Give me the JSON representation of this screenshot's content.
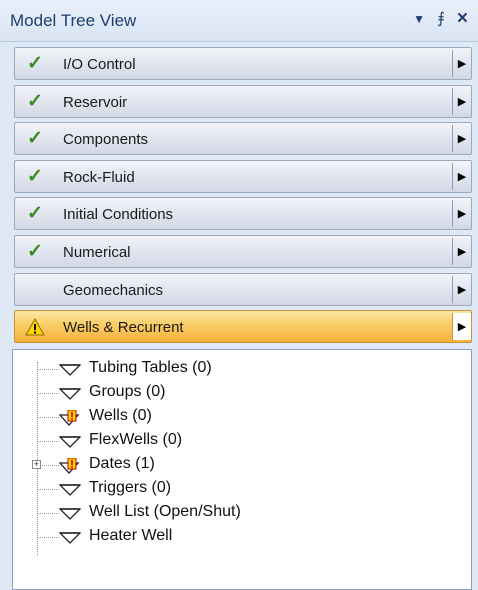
{
  "header": {
    "title": "Model Tree View",
    "dropdown_icon": "chevron-down-icon",
    "pin_icon": "pin-icon",
    "close_icon": "close-icon"
  },
  "sections": [
    {
      "label": "I/O Control",
      "status": "check"
    },
    {
      "label": "Reservoir",
      "status": "check"
    },
    {
      "label": "Components",
      "status": "check"
    },
    {
      "label": "Rock-Fluid",
      "status": "check"
    },
    {
      "label": "Initial Conditions",
      "status": "check"
    },
    {
      "label": "Numerical",
      "status": "check"
    },
    {
      "label": "Geomechanics",
      "status": "none"
    },
    {
      "label": "Wells & Recurrent",
      "status": "warning",
      "active": true
    }
  ],
  "tree": {
    "items": [
      {
        "label": "Tubing Tables (0)",
        "icon": "funnel-icon"
      },
      {
        "label": "Groups (0)",
        "icon": "funnel-icon"
      },
      {
        "label": "Wells (0)",
        "icon": "funnel-warning-icon"
      },
      {
        "label": "FlexWells (0)",
        "icon": "funnel-icon"
      },
      {
        "label": "Dates (1)",
        "icon": "funnel-warning-icon",
        "expandable": true
      },
      {
        "label": "Triggers (0)",
        "icon": "funnel-icon"
      },
      {
        "label": "Well List (Open/Shut)",
        "icon": "funnel-icon"
      },
      {
        "label": "Heater Well",
        "icon": "funnel-icon"
      }
    ]
  },
  "colors": {
    "accent": "#1f3f6e",
    "check": "#3a8a1c",
    "active_section": "#fbcf6a",
    "warning": "#ffd400"
  }
}
